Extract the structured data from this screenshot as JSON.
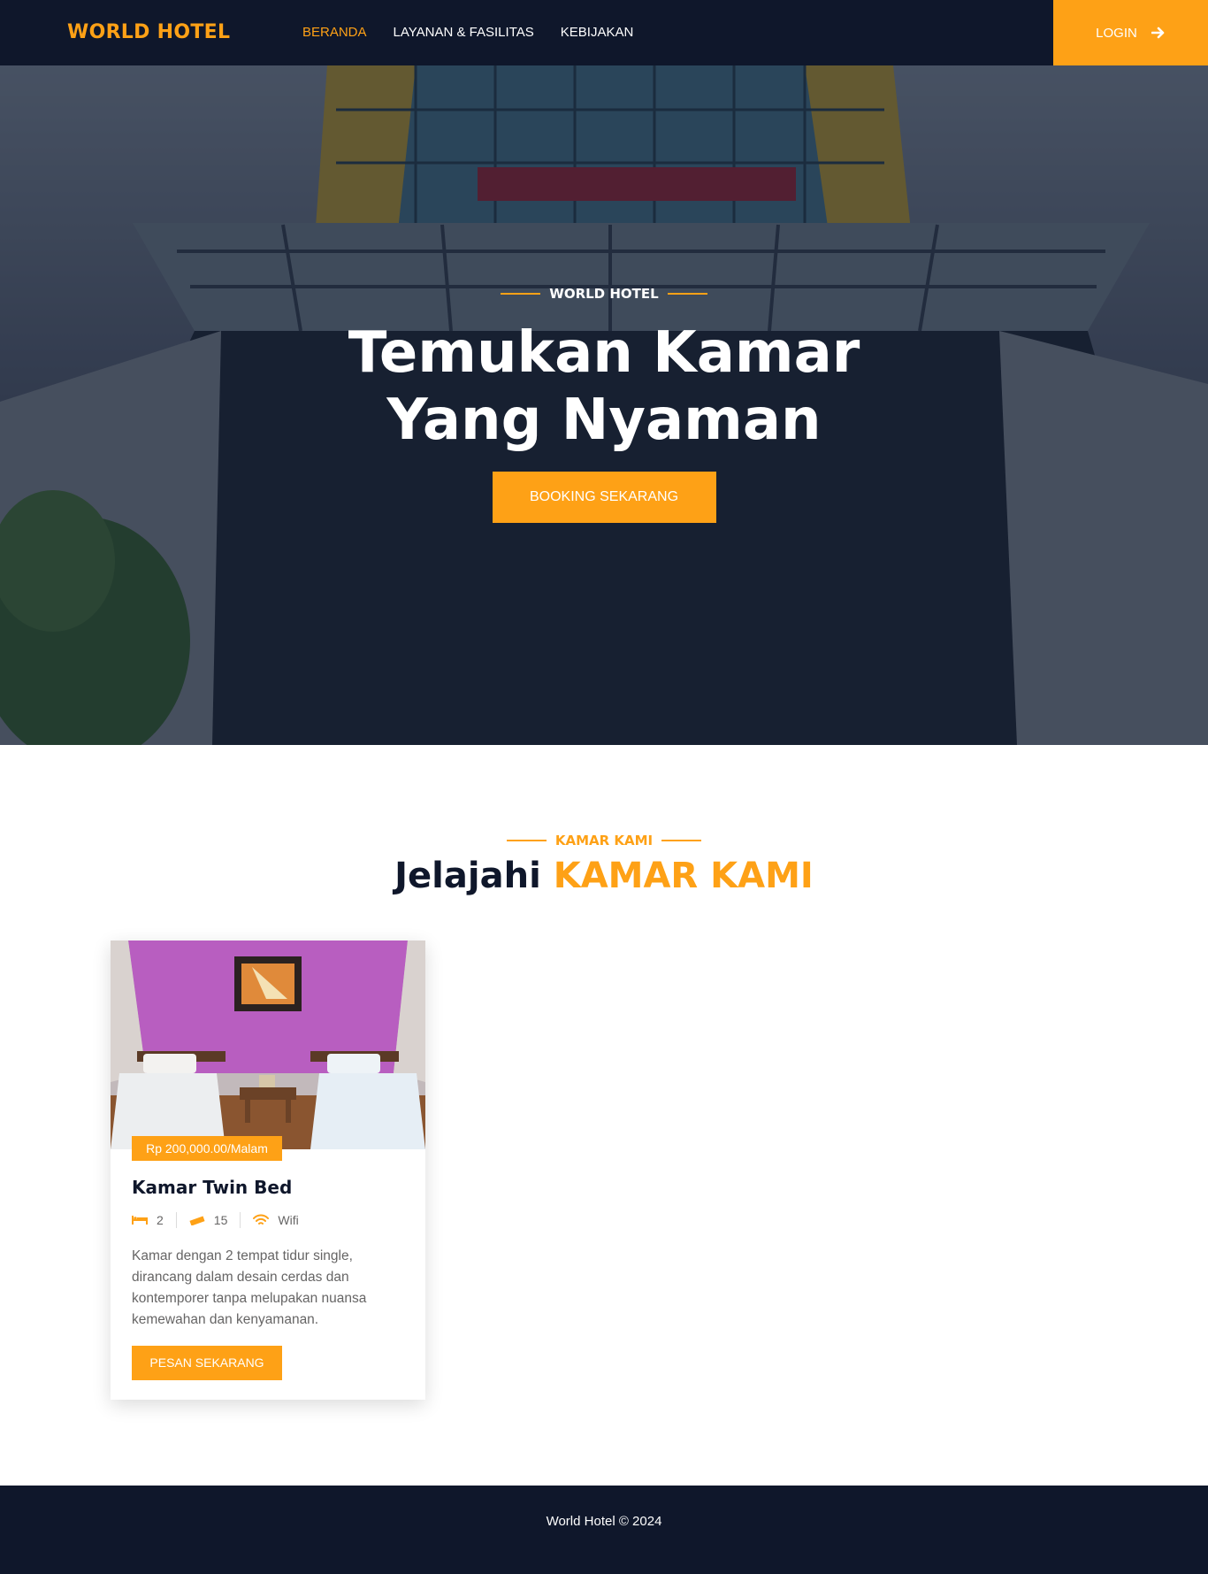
{
  "colors": {
    "primary": "#fea116",
    "dark": "#0f172b",
    "text_muted": "#666565",
    "white": "#ffffff"
  },
  "navbar": {
    "brand": "WORLD HOTEL",
    "links": [
      {
        "label": "BERANDA",
        "active": true
      },
      {
        "label": "LAYANAN & FASILITAS",
        "active": false
      },
      {
        "label": "KEBIJAKAN",
        "active": false
      }
    ],
    "login_label": "LOGIN",
    "login_icon": "arrow-right-icon"
  },
  "hero": {
    "eyebrow": "WORLD HOTEL",
    "title_line1": "Temukan Kamar",
    "title_line2": "Yang Nyaman",
    "cta_label": "BOOKING SEKARANG",
    "background_image": "hotel-building-photo"
  },
  "rooms_section": {
    "eyebrow": "KAMAR KAMI",
    "title_prefix": "Jelajahi",
    "title_accent": "KAMAR KAMI"
  },
  "rooms": [
    {
      "image": "twin-bed-room-photo",
      "price": "Rp 200,000.00/Malam",
      "name": "Kamar Twin Bed",
      "beds": "2",
      "beds_icon": "bed-icon",
      "size": "15",
      "size_icon": "ruler-icon",
      "wifi": "Wifi",
      "wifi_icon": "wifi-icon",
      "description": "Kamar dengan 2 tempat tidur single, dirancang dalam desain cerdas dan kontemporer tanpa melupakan nuansa kemewahan dan kenyamanan.",
      "cta_label": "PESAN SEKARANG"
    }
  ],
  "footer": {
    "text": "World Hotel © 2024"
  }
}
